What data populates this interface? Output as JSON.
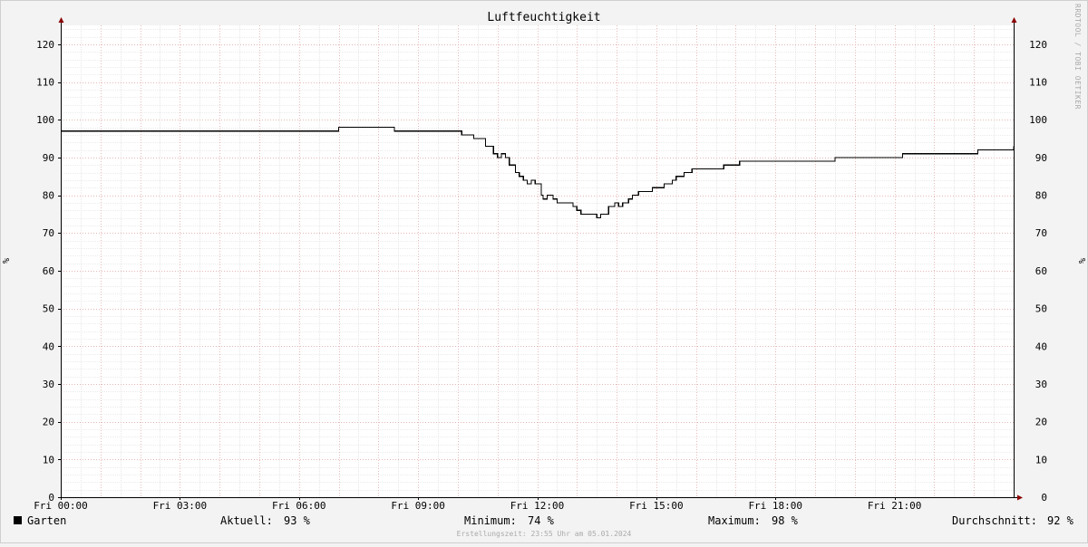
{
  "chart_data": {
    "type": "line",
    "title": "Luftfeuchtigkeit",
    "ylabel_left": "%",
    "ylabel_right": "%",
    "xlim": [
      0,
      24
    ],
    "ylim": [
      0,
      125
    ],
    "yticks": [
      0,
      10,
      20,
      30,
      40,
      50,
      60,
      70,
      80,
      90,
      100,
      110,
      120
    ],
    "xticks": [
      {
        "x": 0,
        "label": "Fri 00:00"
      },
      {
        "x": 3,
        "label": "Fri 03:00"
      },
      {
        "x": 6,
        "label": "Fri 06:00"
      },
      {
        "x": 9,
        "label": "Fri 09:00"
      },
      {
        "x": 12,
        "label": "Fri 12:00"
      },
      {
        "x": 15,
        "label": "Fri 15:00"
      },
      {
        "x": 18,
        "label": "Fri 18:00"
      },
      {
        "x": 21,
        "label": "Fri 21:00"
      }
    ],
    "grid": true,
    "series": [
      {
        "name": "Garten",
        "color": "#000000",
        "step": true,
        "x": [
          0,
          7.0,
          8.4,
          10.1,
          10.4,
          10.7,
          10.9,
          11.0,
          11.1,
          11.2,
          11.3,
          11.45,
          11.55,
          11.65,
          11.75,
          11.85,
          11.95,
          12.1,
          12.15,
          12.25,
          12.4,
          12.5,
          12.9,
          13.0,
          13.1,
          13.5,
          13.6,
          13.8,
          13.95,
          14.05,
          14.15,
          14.3,
          14.4,
          14.55,
          14.9,
          15.2,
          15.4,
          15.5,
          15.7,
          15.9,
          16.7,
          17.1,
          18.6,
          19.5,
          21.2,
          23.1,
          24.0
        ],
        "values": [
          97,
          98,
          97,
          96,
          95,
          93,
          91,
          90,
          91,
          90,
          88,
          86,
          85,
          84,
          83,
          84,
          83,
          80,
          79,
          80,
          79,
          78,
          77,
          76,
          75,
          74,
          75,
          77,
          78,
          77,
          78,
          79,
          80,
          81,
          82,
          83,
          84,
          85,
          86,
          87,
          88,
          89,
          89,
          90,
          91,
          92,
          93
        ]
      }
    ],
    "stats": {
      "current_label": "Aktuell:",
      "current": "93 %",
      "min_label": "Minimum:",
      "min": "74 %",
      "max_label": "Maximum:",
      "max": "98 %",
      "avg_label": "Durchschnitt:",
      "avg": "92 %"
    },
    "footer": "Erstellungszeit: 23:55 Uhr am 05.01.2024",
    "watermark": "RRDTOOL / TOBI OETIKER"
  }
}
